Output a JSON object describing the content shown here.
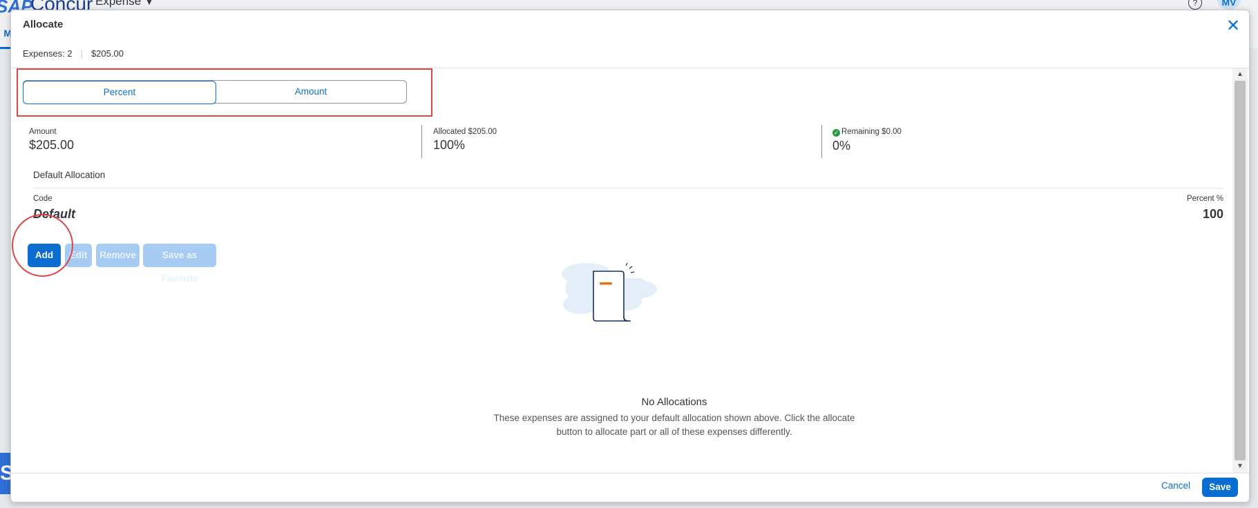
{
  "background": {
    "brand_sap": "SAP",
    "brand_concur": "Concur",
    "menu": "Expense",
    "help_glyph": "?",
    "avatar": "MV",
    "tab_initial": "M",
    "side_initial": "S"
  },
  "dialog": {
    "title": "Allocate",
    "expenses_count": "Expenses: 2",
    "expenses_total": "$205.00"
  },
  "mode_toggle": {
    "options": [
      "Percent",
      "Amount"
    ],
    "selected": "Percent"
  },
  "summary": {
    "amount_label": "Amount",
    "amount_value": "$205.00",
    "allocated_label": "Allocated $205.00",
    "allocated_value": "100%",
    "remaining_label": "Remaining $0.00",
    "remaining_value": "0%"
  },
  "default_allocation": {
    "title": "Default Allocation",
    "code_label": "Code",
    "code_value": "Default",
    "percent_label": "Percent %",
    "percent_value": "100"
  },
  "actions": {
    "add": "Add",
    "edit": "Edit",
    "remove": "Remove",
    "save_favorite": "Save as Favorite"
  },
  "empty_state": {
    "title": "No Allocations",
    "text": "These expenses are assigned to your default allocation shown above. Click the allocate button to allocate part or all of these expenses differently."
  },
  "footer": {
    "cancel": "Cancel",
    "save": "Save"
  },
  "colors": {
    "accent": "#0a6ed1",
    "highlight": "#e04545",
    "success": "#2b9a4a"
  }
}
